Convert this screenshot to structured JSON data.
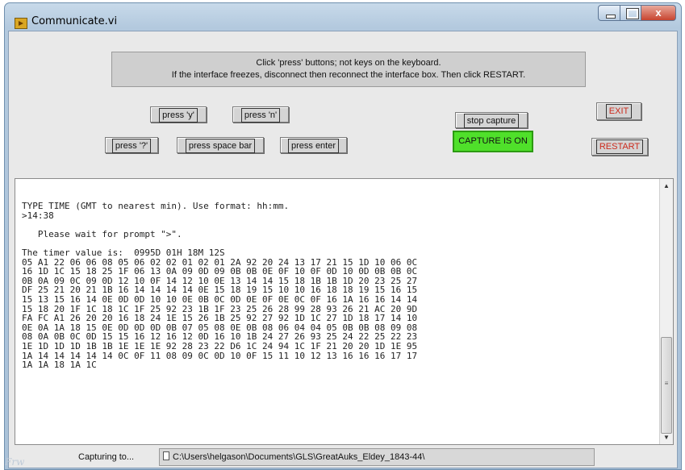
{
  "window": {
    "title": "Communicate.vi",
    "close_glyph": "x"
  },
  "notice": {
    "line1": "Click 'press' buttons; not keys on the keyboard.",
    "line2": "If the interface freezes, disconnect then reconnect the interface box. Then click RESTART."
  },
  "buttons": {
    "press_y": "press 'y'",
    "press_n": "press 'n'",
    "press_q": "press '?'",
    "press_space": "press space bar",
    "press_enter": "press enter",
    "stop_capture": "stop capture",
    "capture_status": "CAPTURE IS ON",
    "exit": "EXIT",
    "restart": "RESTART"
  },
  "terminal": {
    "text": "TYPE TIME (GMT to nearest min). Use format: hh:mm.\n>14:38\n\n   Please wait for prompt \">\".\n\nThe timer value is:  0995D 01H 18M 12S\n05 A1 22 06 06 08 05 06 02 02 01 02 01 2A 92 20 24 13 17 21 15 1D 10 06 0C\n16 1D 1C 15 18 25 1F 06 13 0A 09 0D 09 0B 0B 0E 0F 10 0F 0D 10 0D 0B 0B 0C\n0B 0A 09 0C 09 0D 12 10 0F 14 12 10 0E 13 14 14 15 18 1B 1B 1D 20 23 25 27\nDF 25 21 20 21 1B 16 14 14 14 14 0E 15 18 19 15 10 10 16 18 18 19 15 16 15\n15 13 15 16 14 0E 0D 0D 10 10 0E 0B 0C 0D 0E 0F 0E 0C 0F 16 1A 16 16 14 14\n15 18 20 1F 1C 18 1C 1F 25 92 23 1B 1F 23 25 26 28 99 28 93 26 21 AC 20 9D\nFA FC A1 26 20 20 16 18 24 1E 15 26 1B 25 92 27 92 1D 1C 27 1D 18 17 14 10\n0E 0A 1A 18 15 0E 0D 0D 0D 0B 07 05 08 0E 0B 08 06 04 04 05 0B 0B 08 09 08\n08 0A 0B 0C 0D 15 15 16 12 16 12 0D 16 10 1B 24 27 26 93 25 24 22 25 22 23\n1E 1D 1D 1D 1B 1B 1E 1E 1E 92 28 23 22 D6 1C 24 94 1C 1F 21 20 20 1D 1E 95\n1A 14 14 14 14 14 0C 0F 11 08 09 0C 0D 10 0F 15 11 10 12 13 16 16 16 17 17\n1A 1A 18 1A 1C"
  },
  "capture": {
    "label": "Capturing to...",
    "path": "C:\\Users\\helgason\\Documents\\GLS\\GreatAuks_Eldey_1843-44\\"
  },
  "watermark": "Frw"
}
